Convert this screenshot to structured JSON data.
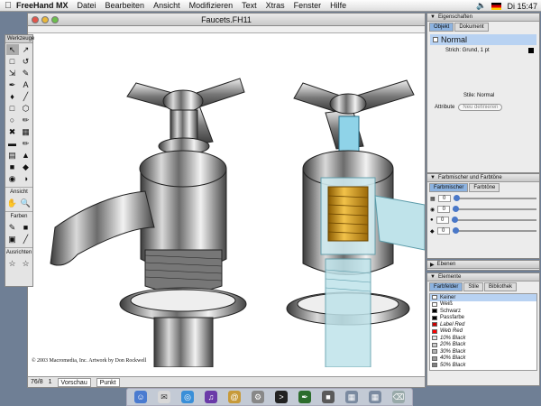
{
  "menubar": {
    "app": "FreeHand MX",
    "items": [
      "Datei",
      "Bearbeiten",
      "Ansicht",
      "Modifizieren",
      "Text",
      "Xtras",
      "Fenster",
      "Hilfe"
    ],
    "clock": "Di 15:47"
  },
  "document": {
    "title": "Faucets.FH11",
    "copyright": "© 2003 Macromedia, Inc. Artwork by Don Rockwell",
    "zoom": "76/8",
    "page": "1",
    "view_mode": "Vorschau",
    "units": "Punkt"
  },
  "toolbox": {
    "title": "Werkzeuge",
    "section_view": "Ansicht",
    "section_colors": "Farben",
    "section_align": "Ausrichten"
  },
  "eigenschaften": {
    "title": "Eigenschaften",
    "tabs": [
      "Objekt",
      "Dokument"
    ],
    "fill_name": "Normal",
    "stroke": "Strich: Grund, 1 pt",
    "style": "Stile: Normal",
    "attribute_label": "Attribute",
    "define_button": "Neu definieren"
  },
  "mixer": {
    "title": "Farbmischer und Farbtöne",
    "tabs": [
      "Farbmischer",
      "Farbtöne"
    ],
    "values": [
      0,
      0,
      0,
      0
    ]
  },
  "ebenen": {
    "title": "Ebenen"
  },
  "elemente": {
    "title": "Elemente",
    "tabs": [
      "Farbfelder",
      "Stile",
      "Bibliothek"
    ],
    "swatches": [
      {
        "name": "Keiner",
        "color": "#ffffff",
        "italic": false
      },
      {
        "name": "Weiß",
        "color": "#ffffff",
        "italic": false
      },
      {
        "name": "Schwarz",
        "color": "#000000",
        "italic": false
      },
      {
        "name": "Passfarbe",
        "color": "#000000",
        "italic": false
      },
      {
        "name": "Label Red",
        "color": "#cc0000",
        "italic": true
      },
      {
        "name": "Web Red",
        "color": "#ff0000",
        "italic": true
      },
      {
        "name": "10% Black",
        "color": "#e6e6e6",
        "italic": true
      },
      {
        "name": "20% Black",
        "color": "#cccccc",
        "italic": true
      },
      {
        "name": "30% Black",
        "color": "#b3b3b3",
        "italic": true
      },
      {
        "name": "40% Black",
        "color": "#999999",
        "italic": true
      },
      {
        "name": "50% Black",
        "color": "#808080",
        "italic": true
      }
    ]
  }
}
